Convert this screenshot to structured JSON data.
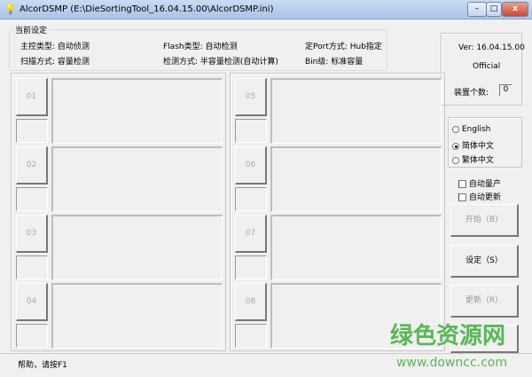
{
  "window": {
    "title": "AlcorDSMP (E:\\DieSortingTool_16.04.15.00\\AlcorDSMP.ini)",
    "minimize": "–",
    "maximize": "□",
    "close": "x"
  },
  "settings": {
    "legend": "当前设定",
    "items": [
      "主控类型: 自动侦测",
      "Flash类型: 自动检测",
      "定Port方式: Hub指定",
      "扫描方式: 容量检测",
      "检测方式: 半容量检测(自动计算)",
      "Bin级: 标准容量"
    ]
  },
  "version": {
    "ver": "Ver: 16.04.15.00",
    "edition": "Official",
    "device_count_label": "装置个数:",
    "device_count": "0"
  },
  "slots": [
    "01",
    "02",
    "03",
    "04",
    "05",
    "06",
    "07",
    "08"
  ],
  "language": {
    "options": [
      "English",
      "简体中文",
      "繁体中文"
    ],
    "selected": 1
  },
  "options": {
    "auto_production": "自动量产",
    "auto_update": "自动更新"
  },
  "buttons": {
    "start": "开始（B）",
    "settings": "设定（S）",
    "update": "更新（R）",
    "fourth": ""
  },
  "status": "帮助，请按F1",
  "watermark": {
    "text": "绿色资源网",
    "url": "www.downcc.com"
  }
}
